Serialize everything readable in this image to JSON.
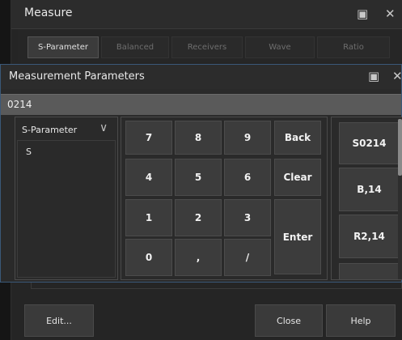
{
  "measure_window": {
    "title": "Measure",
    "tabs": [
      {
        "label": "S-Parameter",
        "active": true
      },
      {
        "label": "Balanced",
        "active": false
      },
      {
        "label": "Receivers",
        "active": false
      },
      {
        "label": "Wave",
        "active": false
      },
      {
        "label": "Ratio",
        "active": false
      }
    ],
    "footer": {
      "edit_label": "Edit...",
      "close_label": "Close",
      "help_label": "Help"
    }
  },
  "dialog": {
    "title": "Measurement Parameters",
    "entry_value": "0214",
    "param_select": {
      "selected": "S-Parameter"
    },
    "param_list": [
      "S"
    ],
    "keypad": {
      "k7": "7",
      "k8": "8",
      "k9": "9",
      "back": "Back",
      "k4": "4",
      "k5": "5",
      "k6": "6",
      "clear": "Clear",
      "k1": "1",
      "k2": "2",
      "k3": "3",
      "enter": "Enter",
      "k0": "0",
      "comma": ",",
      "slash": "/"
    },
    "presets": [
      "S0214",
      "B,14",
      "R2,14",
      ""
    ]
  },
  "icons": {
    "camera": "▣",
    "close": "✕",
    "chevron_down": "∨"
  }
}
